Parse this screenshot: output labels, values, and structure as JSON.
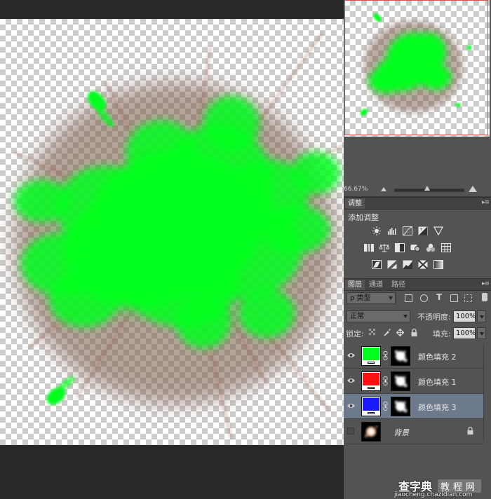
{
  "canvas": {
    "splash_color": "#00ff1e",
    "shadow_color": "#a06050"
  },
  "navigator": {
    "zoom": "66.67%",
    "frame_color": "#d9534f"
  },
  "adjustments": {
    "tab": "调整",
    "title": "添加调整",
    "icons_row1": [
      "brightness-contrast-icon",
      "levels-icon",
      "curves-icon",
      "exposure-icon",
      "vibrance-icon"
    ],
    "icons_row2": [
      "hue-saturation-icon",
      "color-balance-icon",
      "black-white-icon",
      "photo-filter-icon",
      "channel-mixer-icon",
      "color-lookup-icon"
    ],
    "icons_row3": [
      "invert-icon",
      "posterize-icon",
      "threshold-icon",
      "selective-color-icon",
      "gradient-map-icon"
    ]
  },
  "layers_panel": {
    "tabs": [
      "图层",
      "通道",
      "路径"
    ],
    "filter": "ρ 类型",
    "blend_mode": "正常",
    "opacity_label": "不透明度:",
    "opacity_value": "100%",
    "lock_label": "锁定:",
    "fill_label": "填充:",
    "fill_value": "100%",
    "layers": [
      {
        "name": "颜色填充 2",
        "color": "#00ff1e",
        "visible": true,
        "selected": false
      },
      {
        "name": "颜色填充 1",
        "color": "#ff1010",
        "visible": true,
        "selected": false
      },
      {
        "name": "颜色填充 3",
        "color": "#1a1aff",
        "visible": true,
        "selected": true
      },
      {
        "name": "背景",
        "color": "",
        "visible": false,
        "selected": false
      }
    ]
  },
  "watermark": {
    "brand": "查字典",
    "tag": "教程网",
    "url": "jiaocheng.chazidian.com"
  }
}
